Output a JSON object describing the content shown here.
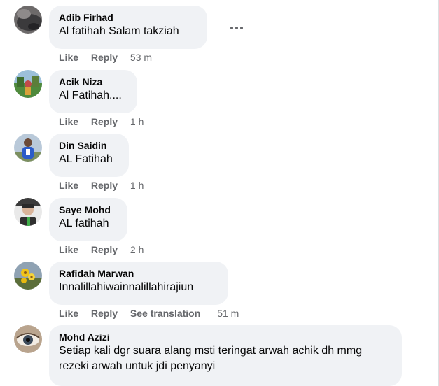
{
  "comments": [
    {
      "author": "Adib Firhad",
      "text": "Al fatihah Salam takziah",
      "like_label": "Like",
      "reply_label": "Reply",
      "time": "53 m",
      "avatar_icon": "profile-photo-dark"
    },
    {
      "author": "Acik Niza",
      "text": "Al Fatihah....",
      "like_label": "Like",
      "reply_label": "Reply",
      "time": "1 h",
      "avatar_icon": "profile-photo-outdoor"
    },
    {
      "author": "Din Saidin",
      "text": "AL Fatihah",
      "like_label": "Like",
      "reply_label": "Reply",
      "time": "1 h",
      "avatar_icon": "profile-photo-blue-shirt"
    },
    {
      "author": "Saye Mohd",
      "text": "AL fatihah",
      "like_label": "Like",
      "reply_label": "Reply",
      "time": "2 h",
      "avatar_icon": "profile-photo-person"
    },
    {
      "author": "Rafidah Marwan",
      "text": "Innalillahiwainnalillahirajiun",
      "like_label": "Like",
      "reply_label": "Reply",
      "see_translation_label": "See translation",
      "time": "51 m",
      "avatar_icon": "profile-photo-flowers"
    },
    {
      "author": "Mohd Azizi",
      "text": "Setiap kali dgr suara alang msti teringat arwah achik dh mmg rezeki arwah untuk jdi penyanyi",
      "avatar_icon": "profile-photo-eye"
    }
  ],
  "more_options_icon": "more-horizontal-icon",
  "colors": {
    "bubble": "#f0f2f5",
    "text": "#050505",
    "secondary": "#65676b"
  }
}
